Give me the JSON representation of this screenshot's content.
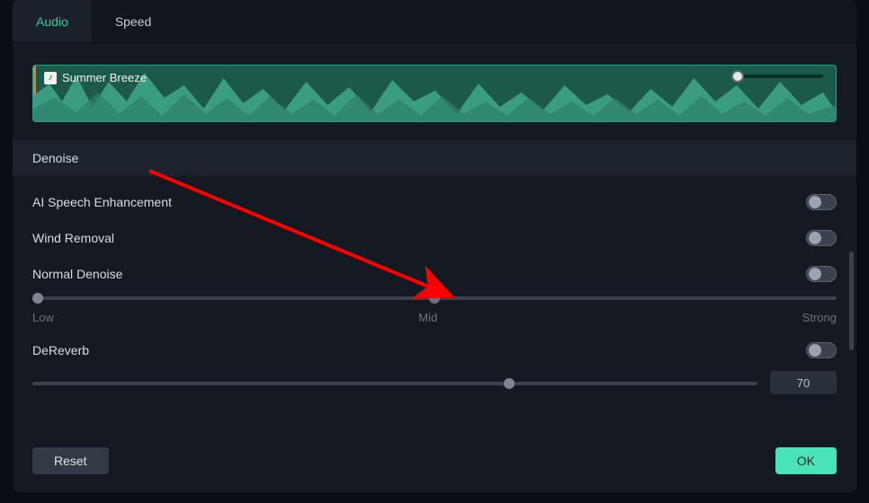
{
  "tabs": {
    "audio": "Audio",
    "speed": "Speed",
    "active": "audio"
  },
  "clip": {
    "title": "Summer Breeze",
    "icon": "music-icon"
  },
  "section": {
    "title": "Denoise"
  },
  "options": {
    "ai_speech": {
      "label": "AI Speech Enhancement",
      "on": false
    },
    "wind": {
      "label": "Wind Removal",
      "on": false
    },
    "normal": {
      "label": "Normal Denoise",
      "on": false,
      "scale": {
        "low": "Low",
        "mid": "Mid",
        "strong": "Strong"
      },
      "value_pos_pct": 0
    },
    "dereverb": {
      "label": "DeReverb",
      "on": false,
      "value": "70",
      "value_pos_pct": 65
    }
  },
  "footer": {
    "reset": "Reset",
    "ok": "OK"
  },
  "colors": {
    "accent": "#33c9a7",
    "ok_bg": "#49e3b7",
    "arrow": "#ff0000"
  }
}
